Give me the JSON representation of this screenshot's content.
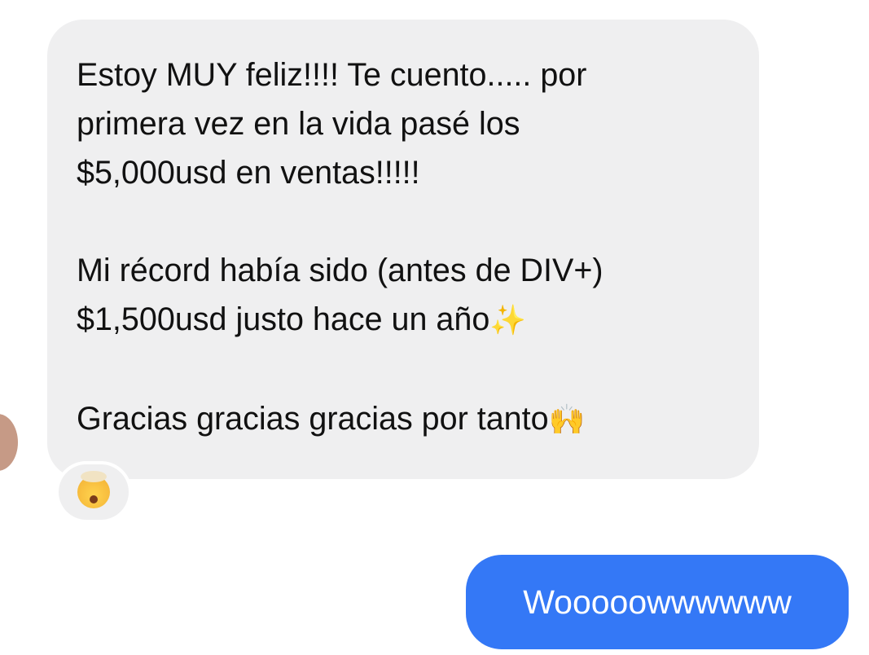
{
  "incoming_message": {
    "paragraph1": {
      "line1": "Estoy MUY feliz!!!! Te cuento..... por",
      "line2": "primera vez en la vida pasé los",
      "line3": "$5,000usd en ventas!!!!!"
    },
    "paragraph2": {
      "line1": "Mi récord había sido (antes de DIV+)",
      "line2": "$1,500usd justo hace un año",
      "line2_emoji": "✨"
    },
    "paragraph3": {
      "line1": "Gracias gracias gracias por tanto",
      "line1_emoji": "🙌"
    },
    "reaction": "exploding-head-emoji"
  },
  "outgoing_message": {
    "text": "Wooooowwwwww"
  },
  "colors": {
    "incoming_bubble": "#efeff0",
    "outgoing_bubble": "#3478f6",
    "avatar": "#c69a86"
  }
}
